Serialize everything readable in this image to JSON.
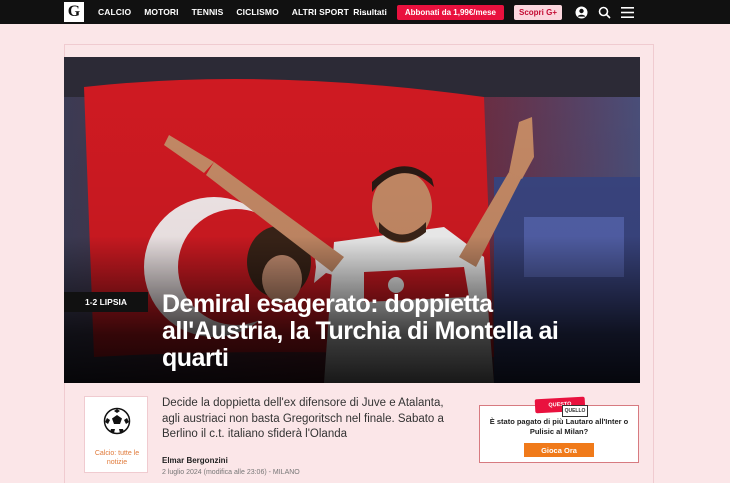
{
  "header": {
    "logo": "G",
    "nav": [
      "CALCIO",
      "MOTORI",
      "TENNIS",
      "CICLISMO",
      "ALTRI SPORT",
      "..."
    ],
    "risultati": "Risultati",
    "subscribe": "Abbonati da 1,99€/mese",
    "scopri": "Scopri G+"
  },
  "hero": {
    "kicker": "1-2 LIPSIA",
    "headline": "Demiral esagerato: doppietta all'Austria, la Turchia di Montella ai quarti"
  },
  "article": {
    "section_link": "Calcio: tutte le notizie",
    "summary": "Decide la doppietta dell'ex difensore di Juve e Atalanta, agli austriaci non basta Gregoritsch nel finale. Sabato a Berlino il c.t. italiano sfiderà l'Olanda",
    "author": "Elmar Bergonzini",
    "date": "2 luglio 2024 (modifica alle 23:06) - MILANO"
  },
  "promo": {
    "tag_top": "QUESTO",
    "tag_bottom": "QUELLO",
    "question": "È stato pagato di più Lautaro all'Inter o Pulisic al Milan?",
    "cta": "Gioca Ora"
  },
  "colors": {
    "brand_red": "#e9113e",
    "background": "#fbe6e8",
    "cta_orange": "#f07a1a"
  }
}
